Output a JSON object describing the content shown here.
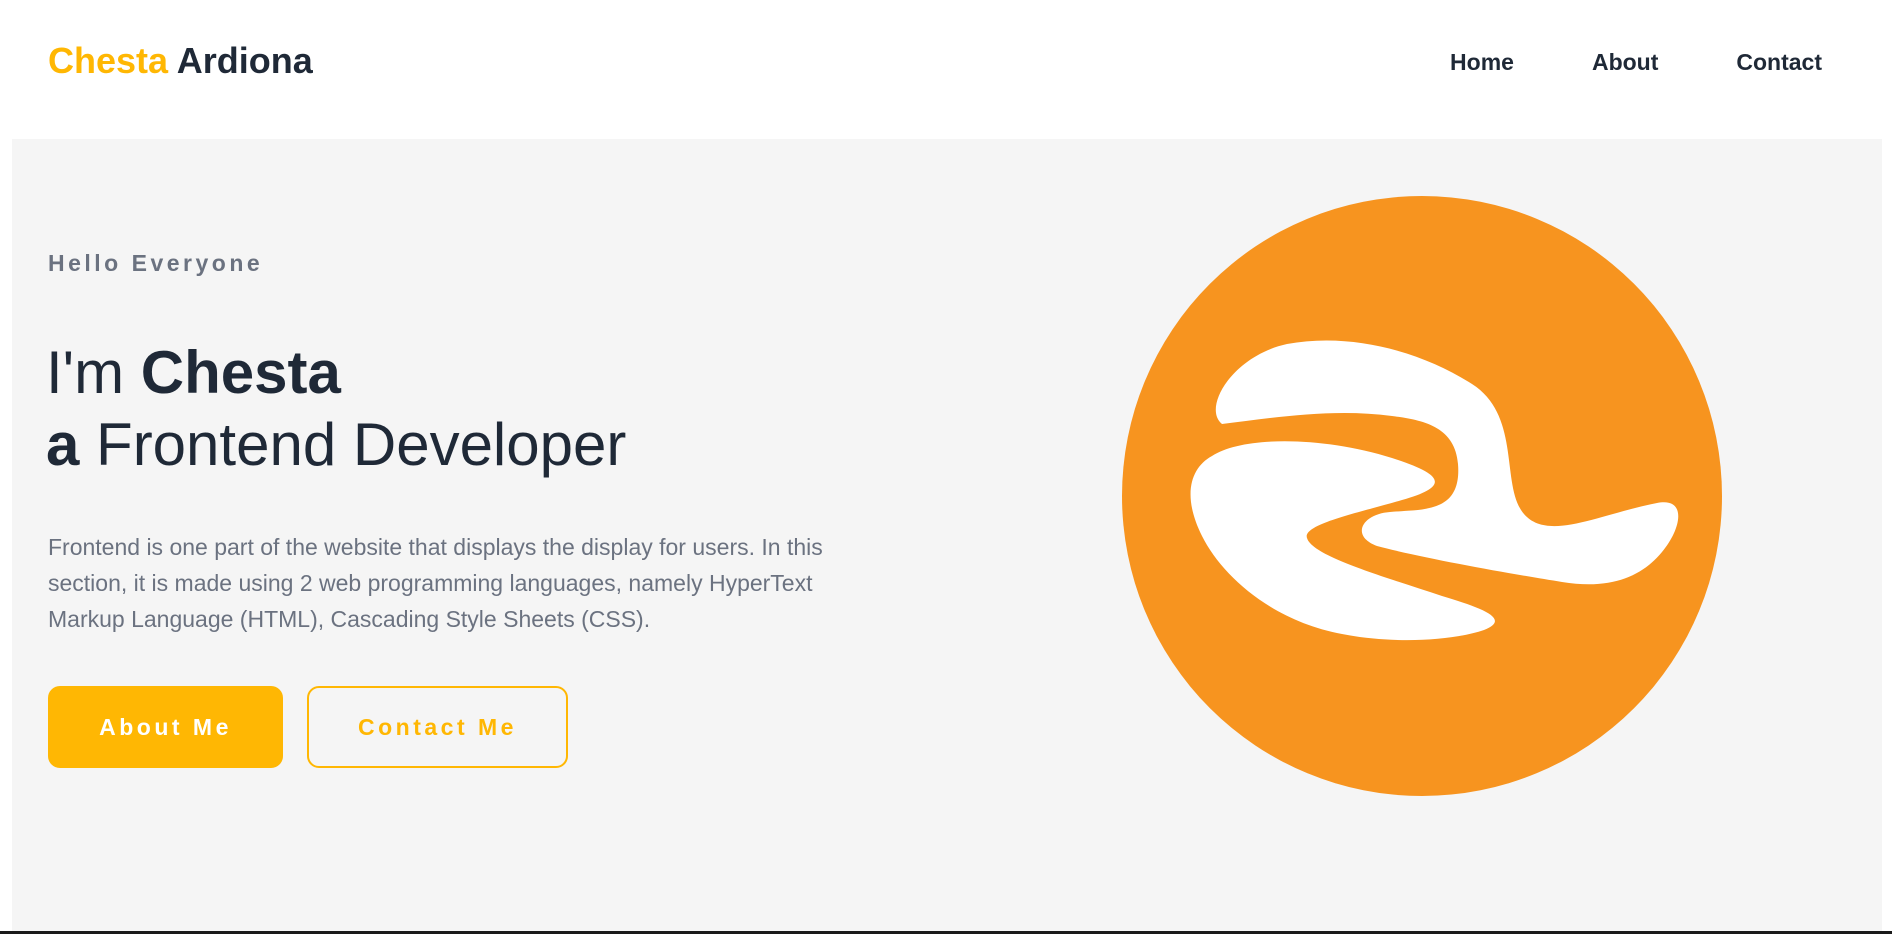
{
  "header": {
    "brand_first": "Chesta",
    "brand_last": "Ardiona",
    "nav": [
      {
        "label": "Home"
      },
      {
        "label": "About"
      },
      {
        "label": "Contact"
      }
    ]
  },
  "hero": {
    "greeting": "Hello Everyone",
    "headline": {
      "line1_prefix": "I'm",
      "line1_name": "Chesta",
      "line2_prefix": "a",
      "line2_role": "Frontend Developer"
    },
    "description": "Frontend is one part of the website that displays the display for users. In this section, it is made using 2 web programming languages, namely HyperText Markup Language (HTML), Cascading Style Sheets (CSS).",
    "buttons": {
      "primary_label": "About Me",
      "secondary_label": "Contact Me"
    },
    "logo": {
      "icon": "wave-logo-icon",
      "circle_color": "#f7941f",
      "shape_color": "#ffffff"
    }
  },
  "colors": {
    "accent": "#ffb703",
    "text_dark": "#1f2937",
    "text_muted": "#6b7280",
    "hero_bg": "#f5f5f5"
  }
}
